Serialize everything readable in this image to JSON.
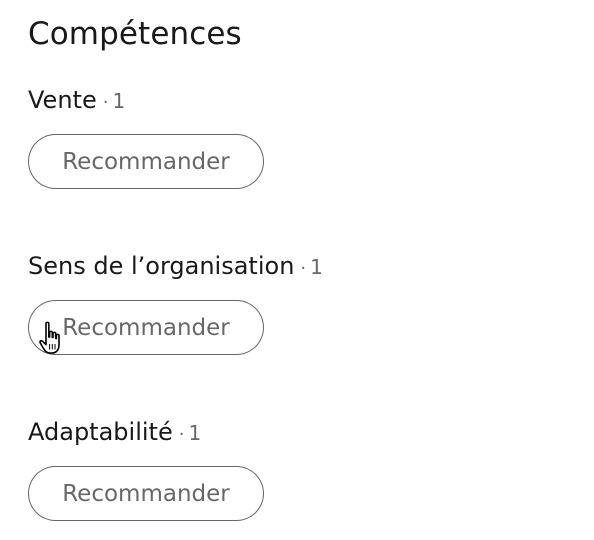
{
  "section": {
    "title": "Compétences"
  },
  "skills": [
    {
      "name": "Vente",
      "separator": "·",
      "count": "1",
      "button_label": "Recommander"
    },
    {
      "name": "Sens de l’organisation",
      "separator": "·",
      "count": "1",
      "button_label": "Recommander"
    },
    {
      "name": "Adaptabilité",
      "separator": "·",
      "count": "1",
      "button_label": "Recommander"
    }
  ],
  "cursor": {
    "icon": "hand-pointer-icon"
  }
}
